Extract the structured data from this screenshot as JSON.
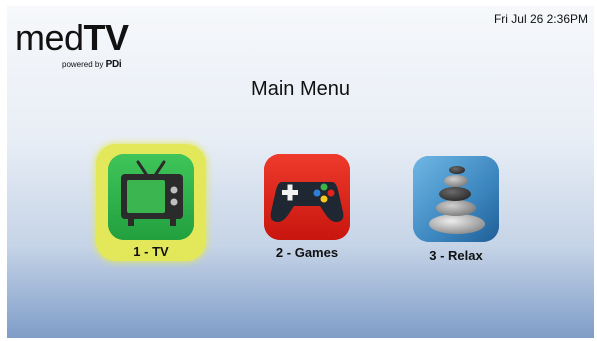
{
  "header": {
    "logo": {
      "main_light": "med",
      "main_bold": "TV",
      "sub_prefix": "powered by ",
      "sub_brand": "PDi"
    },
    "clock": "Fri Jul 26  2:36PM"
  },
  "main": {
    "title": "Main Menu",
    "tiles": [
      {
        "label": "1 - TV",
        "icon": "tv-icon",
        "selected": true
      },
      {
        "label": "2 - Games",
        "icon": "gamepad-icon",
        "selected": false
      },
      {
        "label": "3 - Relax",
        "icon": "stacked-stones-icon",
        "selected": false
      }
    ]
  },
  "colors": {
    "selection_highlight": "#e3e85a",
    "tv_tile": "#2fb24a",
    "games_tile": "#e2231a",
    "relax_tile": "#3b7fb8"
  }
}
